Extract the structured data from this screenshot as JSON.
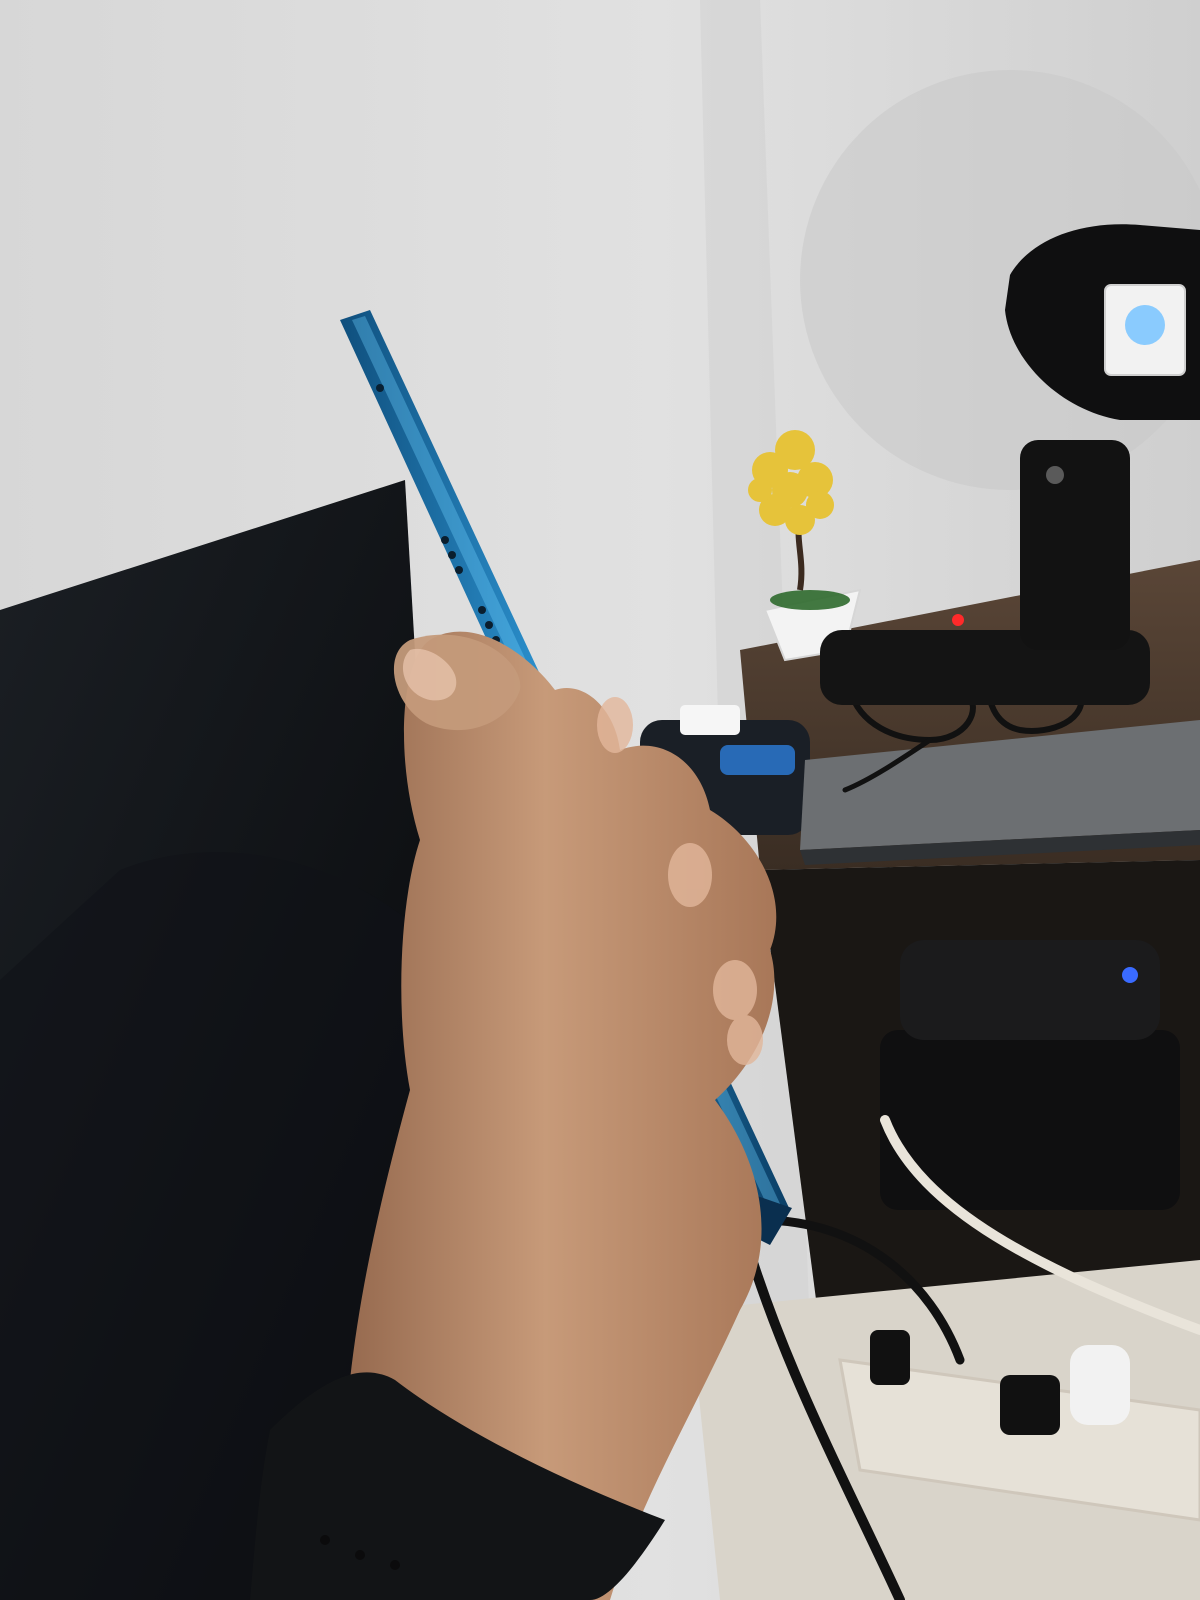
{
  "scene": {
    "description_free": true,
    "colors": {
      "wall": "#d9d9d9",
      "wall_shadow": "#c4c4c4",
      "monitor": "#0d0f12",
      "phone_blue": "#1f7fb8",
      "phone_edge": "#0f4f7d",
      "skin": "#b98a6a",
      "skin_shadow": "#8e6248",
      "desk": "#4a3a2e",
      "fan_black": "#141414",
      "flower": "#e6c33a",
      "cable_white": "#e9e4da",
      "cable_black": "#111111",
      "led_blue": "#3a6bff",
      "led_red": "#ff2a2a"
    }
  }
}
